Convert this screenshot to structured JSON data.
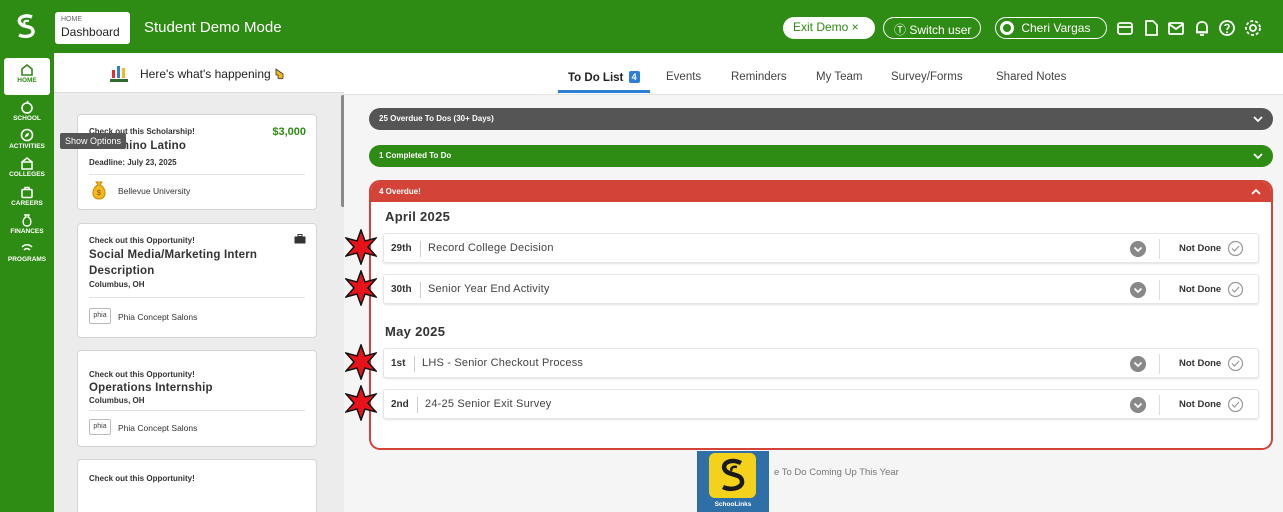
{
  "topbar": {
    "breadcrumb_small": "HOME",
    "breadcrumb_main": "Dashboard",
    "mode_title": "Student Demo Mode",
    "exit_demo": "Exit Demo ×",
    "switch_user": "Switch user",
    "user_name": "Cheri Vargas",
    "icons": [
      "wallet-icon",
      "document-icon",
      "mail-icon",
      "bell-icon",
      "help-icon",
      "settings-icon"
    ],
    "brand_color": "#2e8b13"
  },
  "leftnav": {
    "items": [
      {
        "label": "HOME",
        "icon": "home-icon"
      },
      {
        "label": "SCHOOL",
        "icon": "apple-icon"
      },
      {
        "label": "ACTIVITIES",
        "icon": "compass-icon"
      },
      {
        "label": "COLLEGES",
        "icon": "college-icon"
      },
      {
        "label": "CAREERS",
        "icon": "briefcase-icon"
      },
      {
        "label": "FINANCES",
        "icon": "money-bag-icon"
      },
      {
        "label": "PROGRAMS",
        "icon": "programs-icon"
      }
    ],
    "tooltip": "Show Options"
  },
  "feed": {
    "title": "Here's what's happening",
    "cards": [
      {
        "kicker": "Check out this Scholarship!",
        "title": "El Camino Latino",
        "sub": "Deadline: July 23, 2025",
        "amount": "$3,000",
        "org": "Bellevue University"
      },
      {
        "kicker": "Check out this Opportunity!",
        "title": "Social Media/Marketing Intern Description",
        "sub": "Columbus, OH",
        "org": "Phia Concept Salons",
        "logo": "phia"
      },
      {
        "kicker": "Check out this Opportunity!",
        "title": "Operations Internship",
        "sub": "Columbus, OH",
        "org": "Phia Concept Salons",
        "logo": "phia"
      },
      {
        "kicker": "Check out this Opportunity!"
      }
    ]
  },
  "tabs": [
    {
      "label": "To Do List",
      "badge": "4",
      "active": true
    },
    {
      "label": "Events"
    },
    {
      "label": "Reminders"
    },
    {
      "label": "My Team"
    },
    {
      "label": "Survey/Forms"
    },
    {
      "label": "Shared Notes"
    }
  ],
  "todo": {
    "overdue_old": "25 Overdue To Dos (30+ Days)",
    "completed": "1 Completed To Do",
    "overdue_header": "4 Overdue!",
    "groups": [
      {
        "month": "April 2025",
        "items": [
          {
            "day": "29th",
            "title": "Record College Decision",
            "status": "Not Done"
          },
          {
            "day": "30th",
            "title": "Senior Year End Activity",
            "status": "Not Done"
          }
        ]
      },
      {
        "month": "May 2025",
        "items": [
          {
            "day": "1st",
            "title": "LHS - Senior Checkout Process",
            "status": "Not Done"
          },
          {
            "day": "2nd",
            "title": "24-25 Senior Exit Survey",
            "status": "Not Done"
          }
        ]
      }
    ],
    "footer": "e To Do Coming Up This Year",
    "overdue_color": "#d44337"
  },
  "app_tile": {
    "label": "SchooLinks"
  }
}
